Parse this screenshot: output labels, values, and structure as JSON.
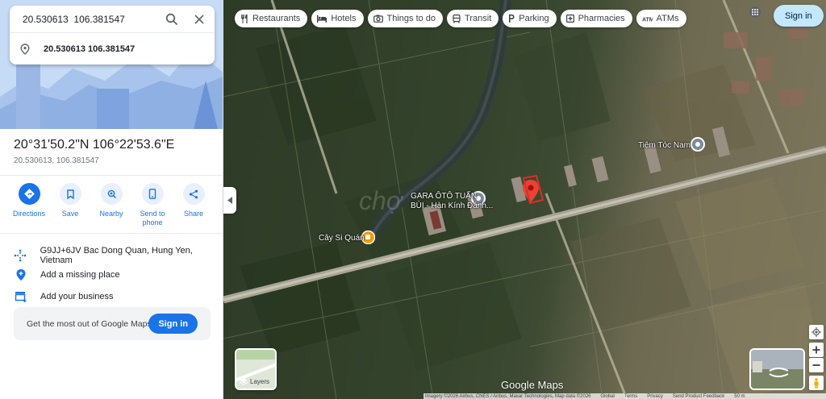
{
  "search": {
    "query": "20.530613  106.381547",
    "suggestion": "20.530613 106.381547"
  },
  "place": {
    "title": "20°31'50.2\"N 106°22'53.6\"E",
    "decimal": "20.530613, 106.381547"
  },
  "actions": [
    {
      "label": "Directions",
      "icon": "directions-icon"
    },
    {
      "label": "Save",
      "icon": "bookmark-icon"
    },
    {
      "label": "Nearby",
      "icon": "nearby-icon"
    },
    {
      "label": "Send to phone",
      "icon": "phone-icon"
    },
    {
      "label": "Share",
      "icon": "share-icon"
    }
  ],
  "info": {
    "plus_code": "G9JJ+6JV Bac Dong Quan, Hung Yen, Vietnam",
    "add_place": "Add a missing place",
    "add_business": "Add your business"
  },
  "signin_card": {
    "text": "Get the most out of Google Maps",
    "button": "Sign in"
  },
  "chips": [
    "Restaurants",
    "Hotels",
    "Things to do",
    "Transit",
    "Parking",
    "Pharmacies",
    "ATMs"
  ],
  "header": {
    "signin": "Sign in"
  },
  "map_labels": {
    "gara_line1": "GARA ÔTÔ TUẤN",
    "gara_line2": "BÙI - Hàn Kính Đánh...",
    "tiem_toc": "Tiệm Tóc Nam",
    "cay_si": "Cây Si Quán"
  },
  "layers_label": "Layers",
  "google_logo": "Google Maps",
  "footer": [
    "Imagery ©2026 Airbus, CNES / Airbus, Maxar Technologies, Map data ©2026",
    "Global",
    "Terms",
    "Privacy",
    "Send Product Feedback",
    "50 m"
  ],
  "colors": {
    "accent": "#1a73e8",
    "pin": "#ea4335",
    "signin_bg": "#c2e7ff"
  }
}
